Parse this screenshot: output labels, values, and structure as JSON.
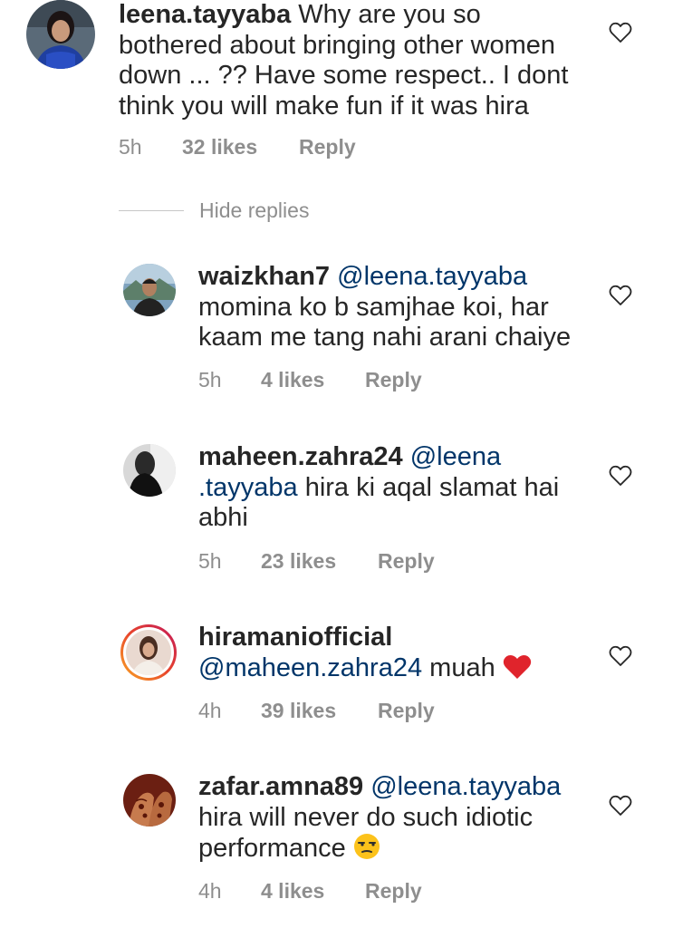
{
  "colors": {
    "text": "#262626",
    "secondary": "#8e8e8e",
    "mention": "#003569",
    "heart_emoji": "#e0242c"
  },
  "hide_replies_label": "Hide replies",
  "comments": [
    {
      "username": "leena.tayyaba",
      "text": " Why are you so bothered about bringing other women down ... ?? Have some respect.. I dont think you will make fun if it was hira",
      "time": "5h",
      "likes": "32 likes",
      "reply": "Reply",
      "avatar_icon": "profile-photo"
    },
    {
      "username": "waizkhan7",
      "mention": "@leena.tayyaba",
      "text": "momina ko b samjhae koi, har kaam me tang nahi arani chaiye",
      "time": "5h",
      "likes": "4 likes",
      "reply": "Reply",
      "avatar_icon": "profile-photo"
    },
    {
      "username": "maheen.zahra24",
      "mention_part1": "@leena",
      "mention_part2": ".tayyaba",
      "text": " hira ki aqal slamat hai abhi",
      "time": "5h",
      "likes": "23 likes",
      "reply": "Reply",
      "avatar_icon": "profile-photo"
    },
    {
      "username": "hiramaniofficial",
      "mention": "@maheen.zahra24",
      "text": " muah ",
      "emoji": "red-heart-emoji",
      "time": "4h",
      "likes": "39 likes",
      "reply": "Reply",
      "avatar_icon": "profile-photo-story-ring"
    },
    {
      "username": "zafar.amna89",
      "mention": "@leena.tayyaba",
      "text": "hira will never do such idiotic performance ",
      "emoji": "unamused-face-emoji",
      "time": "4h",
      "likes": "4 likes",
      "reply": "Reply",
      "avatar_icon": "profile-photo"
    }
  ],
  "like_icon": "heart-outline-icon"
}
